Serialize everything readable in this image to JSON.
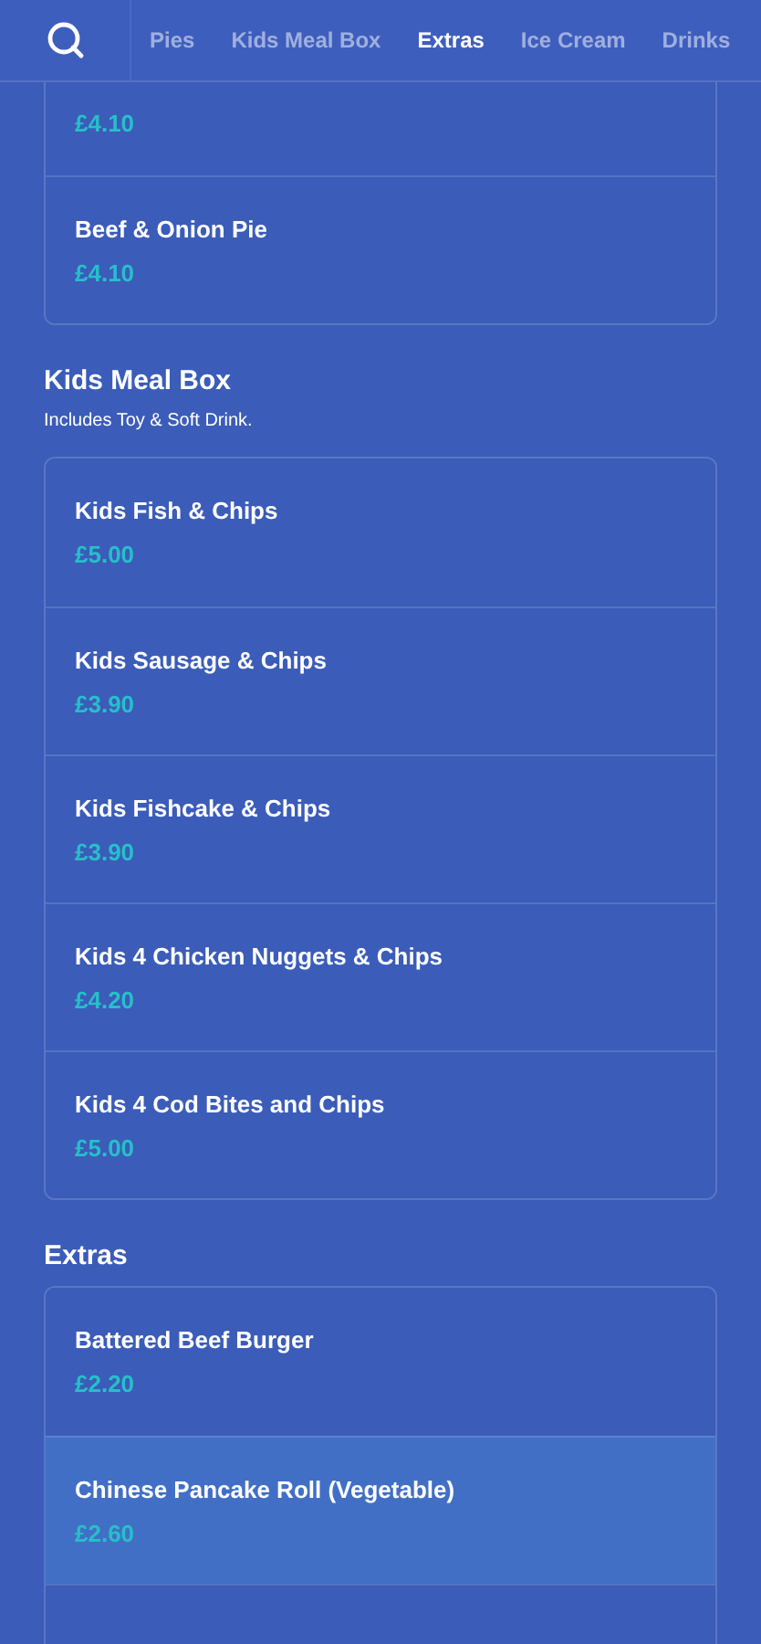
{
  "tabs": [
    {
      "label": "Pies",
      "selected": false
    },
    {
      "label": "Kids Meal Box",
      "selected": false
    },
    {
      "label": "Extras",
      "selected": true
    },
    {
      "label": "Ice Cream",
      "selected": false
    },
    {
      "label": "Drinks",
      "selected": false
    }
  ],
  "sections": [
    {
      "items": [
        {
          "price": "£4.10",
          "selected": false
        },
        {
          "name": "Beef & Onion Pie",
          "price": "£4.10",
          "selected": false
        }
      ]
    },
    {
      "title": "Kids Meal Box",
      "subtitle": "Includes Toy & Soft Drink.",
      "items": [
        {
          "name": "Kids Fish & Chips",
          "price": "£5.00",
          "selected": false
        },
        {
          "name": "Kids Sausage & Chips",
          "price": "£3.90",
          "selected": false
        },
        {
          "name": "Kids Fishcake & Chips",
          "price": "£3.90",
          "selected": false
        },
        {
          "name": "Kids 4 Chicken Nuggets & Chips",
          "price": "£4.20",
          "selected": false
        },
        {
          "name": "Kids 4 Cod Bites and Chips",
          "price": "£5.00",
          "selected": false
        }
      ]
    },
    {
      "title": "Extras",
      "items": [
        {
          "name": "Battered Beef Burger",
          "price": "£2.20",
          "selected": false
        },
        {
          "name": "Chinese Pancake Roll (Vegetable)",
          "price": "£2.60",
          "selected": true
        },
        {
          "selected": false
        }
      ]
    }
  ]
}
